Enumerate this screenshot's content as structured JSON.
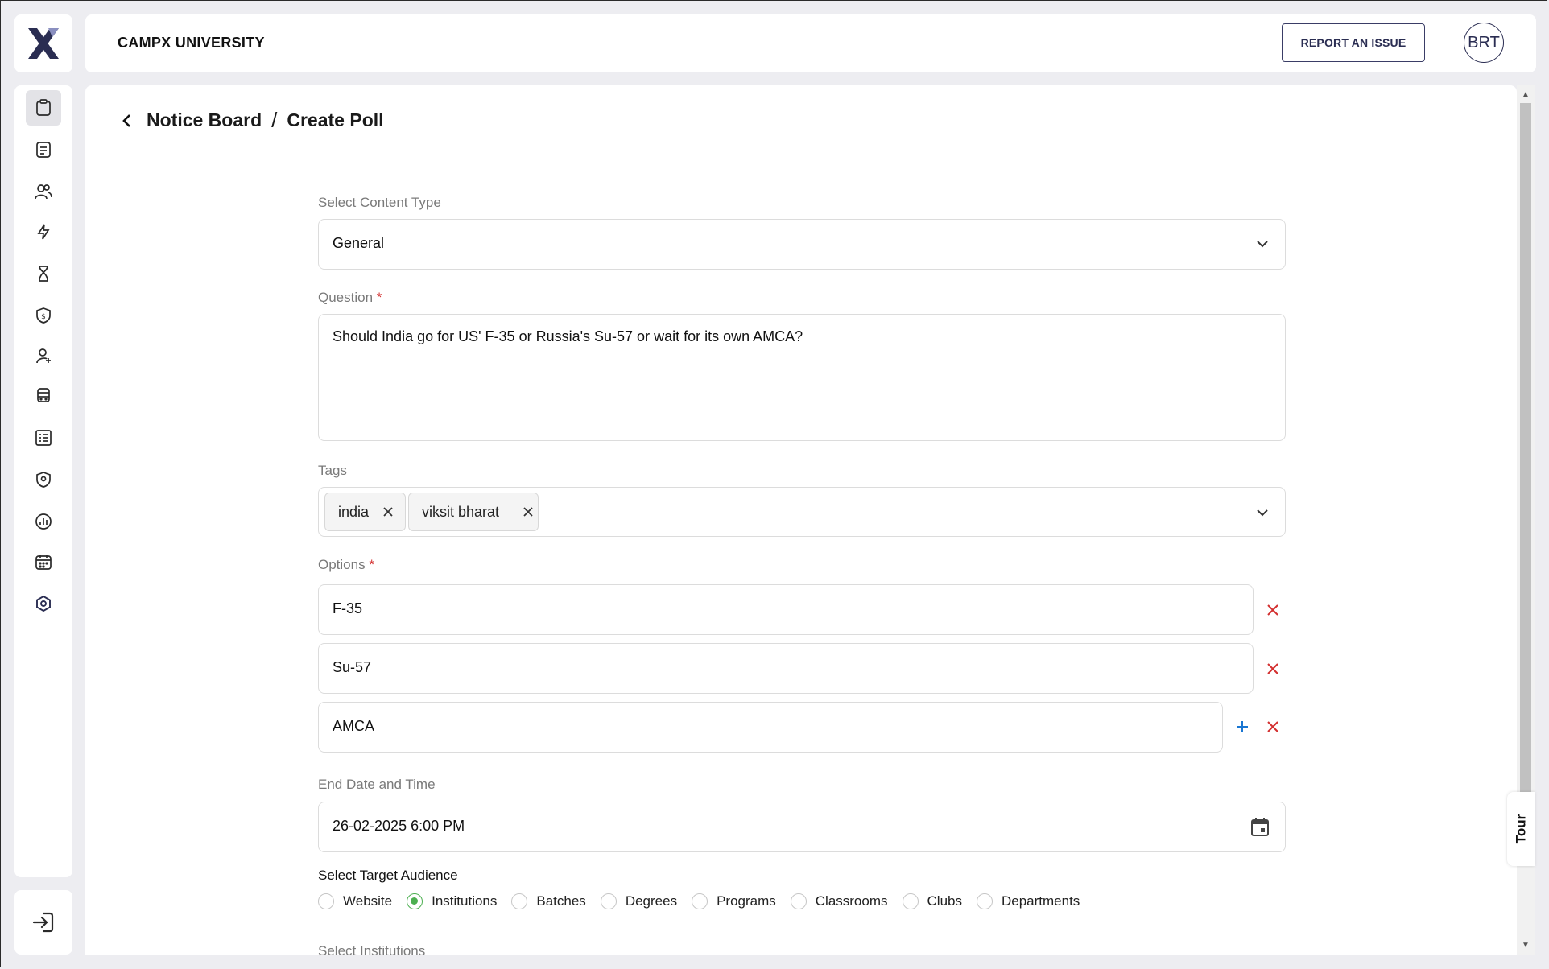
{
  "app": {
    "name": "CAMPX UNIVERSITY",
    "report_label": "REPORT AN ISSUE",
    "avatar_initials": "BRT",
    "tour_label": "Tour"
  },
  "breadcrumb": {
    "parent": "Notice Board",
    "separator": "/",
    "current": "Create Poll"
  },
  "form": {
    "content_type": {
      "label": "Select Content Type",
      "value": "General"
    },
    "question": {
      "label": "Question",
      "required_mark": "*",
      "value": "Should India go for US' F-35 or Russia's Su-57 or wait for its own AMCA?"
    },
    "tags": {
      "label": "Tags",
      "chips": [
        "india",
        "viksit bharat"
      ]
    },
    "options": {
      "label": "Options",
      "required_mark": "*",
      "items": [
        "F-35",
        "Su-57",
        "AMCA"
      ]
    },
    "end_date": {
      "label": "End Date and Time",
      "value": "26-02-2025 6:00 PM"
    },
    "audience": {
      "label": "Select Target Audience",
      "choices": [
        "Website",
        "Institutions",
        "Batches",
        "Degrees",
        "Programs",
        "Classrooms",
        "Clubs",
        "Departments"
      ],
      "selected": "Institutions"
    },
    "next_label": "Select Institutions"
  },
  "sidebar": {
    "items": [
      "clipboard-icon",
      "document-icon",
      "users-icon",
      "lightning-icon",
      "hourglass-icon",
      "shield-dollar-icon",
      "user-add-icon",
      "bus-icon",
      "list-icon",
      "location-shield-icon",
      "analytics-icon",
      "calendar-icon",
      "settings-hex-icon"
    ],
    "active": "clipboard-icon"
  },
  "colors": {
    "brand": "#2a2d52",
    "accent_red": "#d32f2f",
    "accent_blue": "#1976d2",
    "radio_selected": "#4caf50"
  }
}
